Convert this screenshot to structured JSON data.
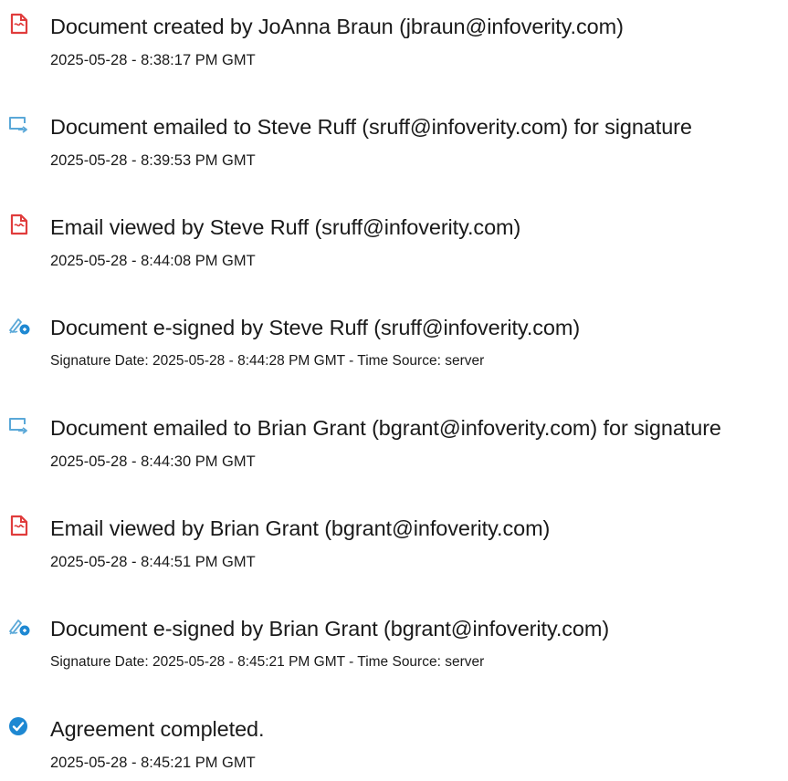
{
  "colors": {
    "red_icon": "#e03c3c",
    "blue_icon": "#5aa8d8",
    "check_blue": "#1e88d2",
    "text": "#1a1a1a"
  },
  "entries": [
    {
      "icon": "document-icon",
      "title": "Document created by JoAnna Braun (jbraun@infoverity.com)",
      "subtitle": "2025-05-28 - 8:38:17 PM GMT"
    },
    {
      "icon": "email-sent-icon",
      "title": "Document emailed to Steve Ruff (sruff@infoverity.com) for signature",
      "subtitle": "2025-05-28 - 8:39:53 PM GMT"
    },
    {
      "icon": "document-icon",
      "title": "Email viewed by Steve Ruff (sruff@infoverity.com)",
      "subtitle": "2025-05-28 - 8:44:08 PM GMT"
    },
    {
      "icon": "e-sign-icon",
      "title": "Document e-signed by Steve Ruff (sruff@infoverity.com)",
      "subtitle": "Signature Date: 2025-05-28 - 8:44:28 PM GMT - Time Source: server"
    },
    {
      "icon": "email-sent-icon",
      "title": "Document emailed to Brian Grant (bgrant@infoverity.com) for signature",
      "subtitle": "2025-05-28 - 8:44:30 PM GMT"
    },
    {
      "icon": "document-icon",
      "title": "Email viewed by Brian Grant (bgrant@infoverity.com)",
      "subtitle": "2025-05-28 - 8:44:51 PM GMT"
    },
    {
      "icon": "e-sign-icon",
      "title": "Document e-signed by Brian Grant (bgrant@infoverity.com)",
      "subtitle": "Signature Date: 2025-05-28 - 8:45:21 PM GMT - Time Source: server"
    },
    {
      "icon": "check-circle-icon",
      "title": "Agreement completed.",
      "subtitle": "2025-05-28 - 8:45:21 PM GMT"
    }
  ]
}
